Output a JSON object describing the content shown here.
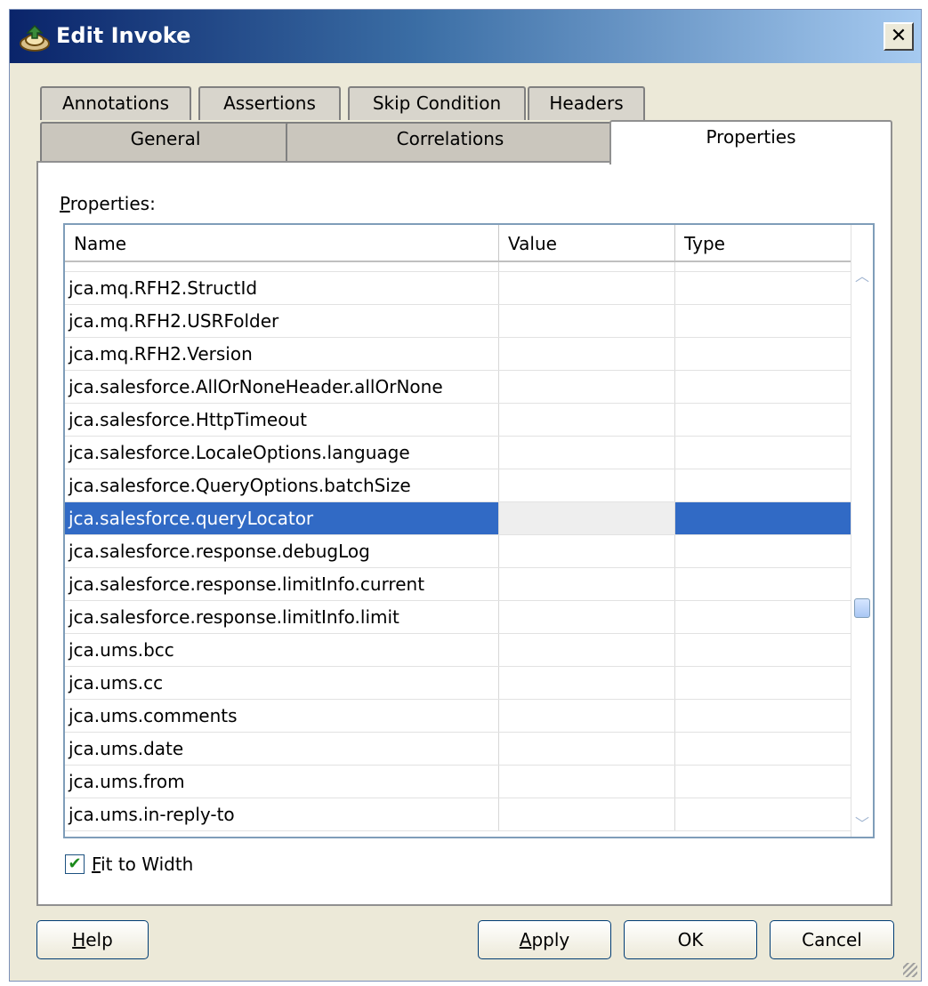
{
  "window": {
    "title": "Edit Invoke",
    "close_glyph": "✕"
  },
  "tabs_back": [
    "Annotations",
    "Assertions",
    "Skip Condition",
    "Headers"
  ],
  "tabs_front": [
    "General",
    "Correlations",
    "Properties"
  ],
  "active_tab": "Properties",
  "panel": {
    "properties_label_mnemonic": "P",
    "properties_label_rest": "roperties:"
  },
  "grid": {
    "columns": [
      "Name",
      "Value",
      "Type"
    ],
    "rows": [
      {
        "name": "jca.mq.RFH2.StructId",
        "value": "",
        "type": ""
      },
      {
        "name": "jca.mq.RFH2.USRFolder",
        "value": "",
        "type": ""
      },
      {
        "name": "jca.mq.RFH2.Version",
        "value": "",
        "type": ""
      },
      {
        "name": "jca.salesforce.AllOrNoneHeader.allOrNone",
        "value": "",
        "type": ""
      },
      {
        "name": "jca.salesforce.HttpTimeout",
        "value": "",
        "type": ""
      },
      {
        "name": "jca.salesforce.LocaleOptions.language",
        "value": "",
        "type": ""
      },
      {
        "name": "jca.salesforce.QueryOptions.batchSize",
        "value": "",
        "type": ""
      },
      {
        "name": "jca.salesforce.queryLocator",
        "value": "",
        "type": "",
        "selected": true
      },
      {
        "name": "jca.salesforce.response.debugLog",
        "value": "",
        "type": ""
      },
      {
        "name": "jca.salesforce.response.limitInfo.current",
        "value": "",
        "type": ""
      },
      {
        "name": "jca.salesforce.response.limitInfo.limit",
        "value": "",
        "type": ""
      },
      {
        "name": "jca.ums.bcc",
        "value": "",
        "type": ""
      },
      {
        "name": "jca.ums.cc",
        "value": "",
        "type": ""
      },
      {
        "name": "jca.ums.comments",
        "value": "",
        "type": ""
      },
      {
        "name": "jca.ums.date",
        "value": "",
        "type": ""
      },
      {
        "name": "jca.ums.from",
        "value": "",
        "type": ""
      },
      {
        "name": "jca.ums.in-reply-to",
        "value": "",
        "type": ""
      }
    ],
    "ellipsis_button": "...",
    "scroll_position": 0.62
  },
  "fit_to_width": {
    "checked": true,
    "mnemonic": "F",
    "rest": "it to Width"
  },
  "buttons": {
    "help_mnemonic": "H",
    "help_rest": "elp",
    "apply_mnemonic": "A",
    "apply_rest": "pply",
    "ok": "OK",
    "cancel": "Cancel"
  }
}
